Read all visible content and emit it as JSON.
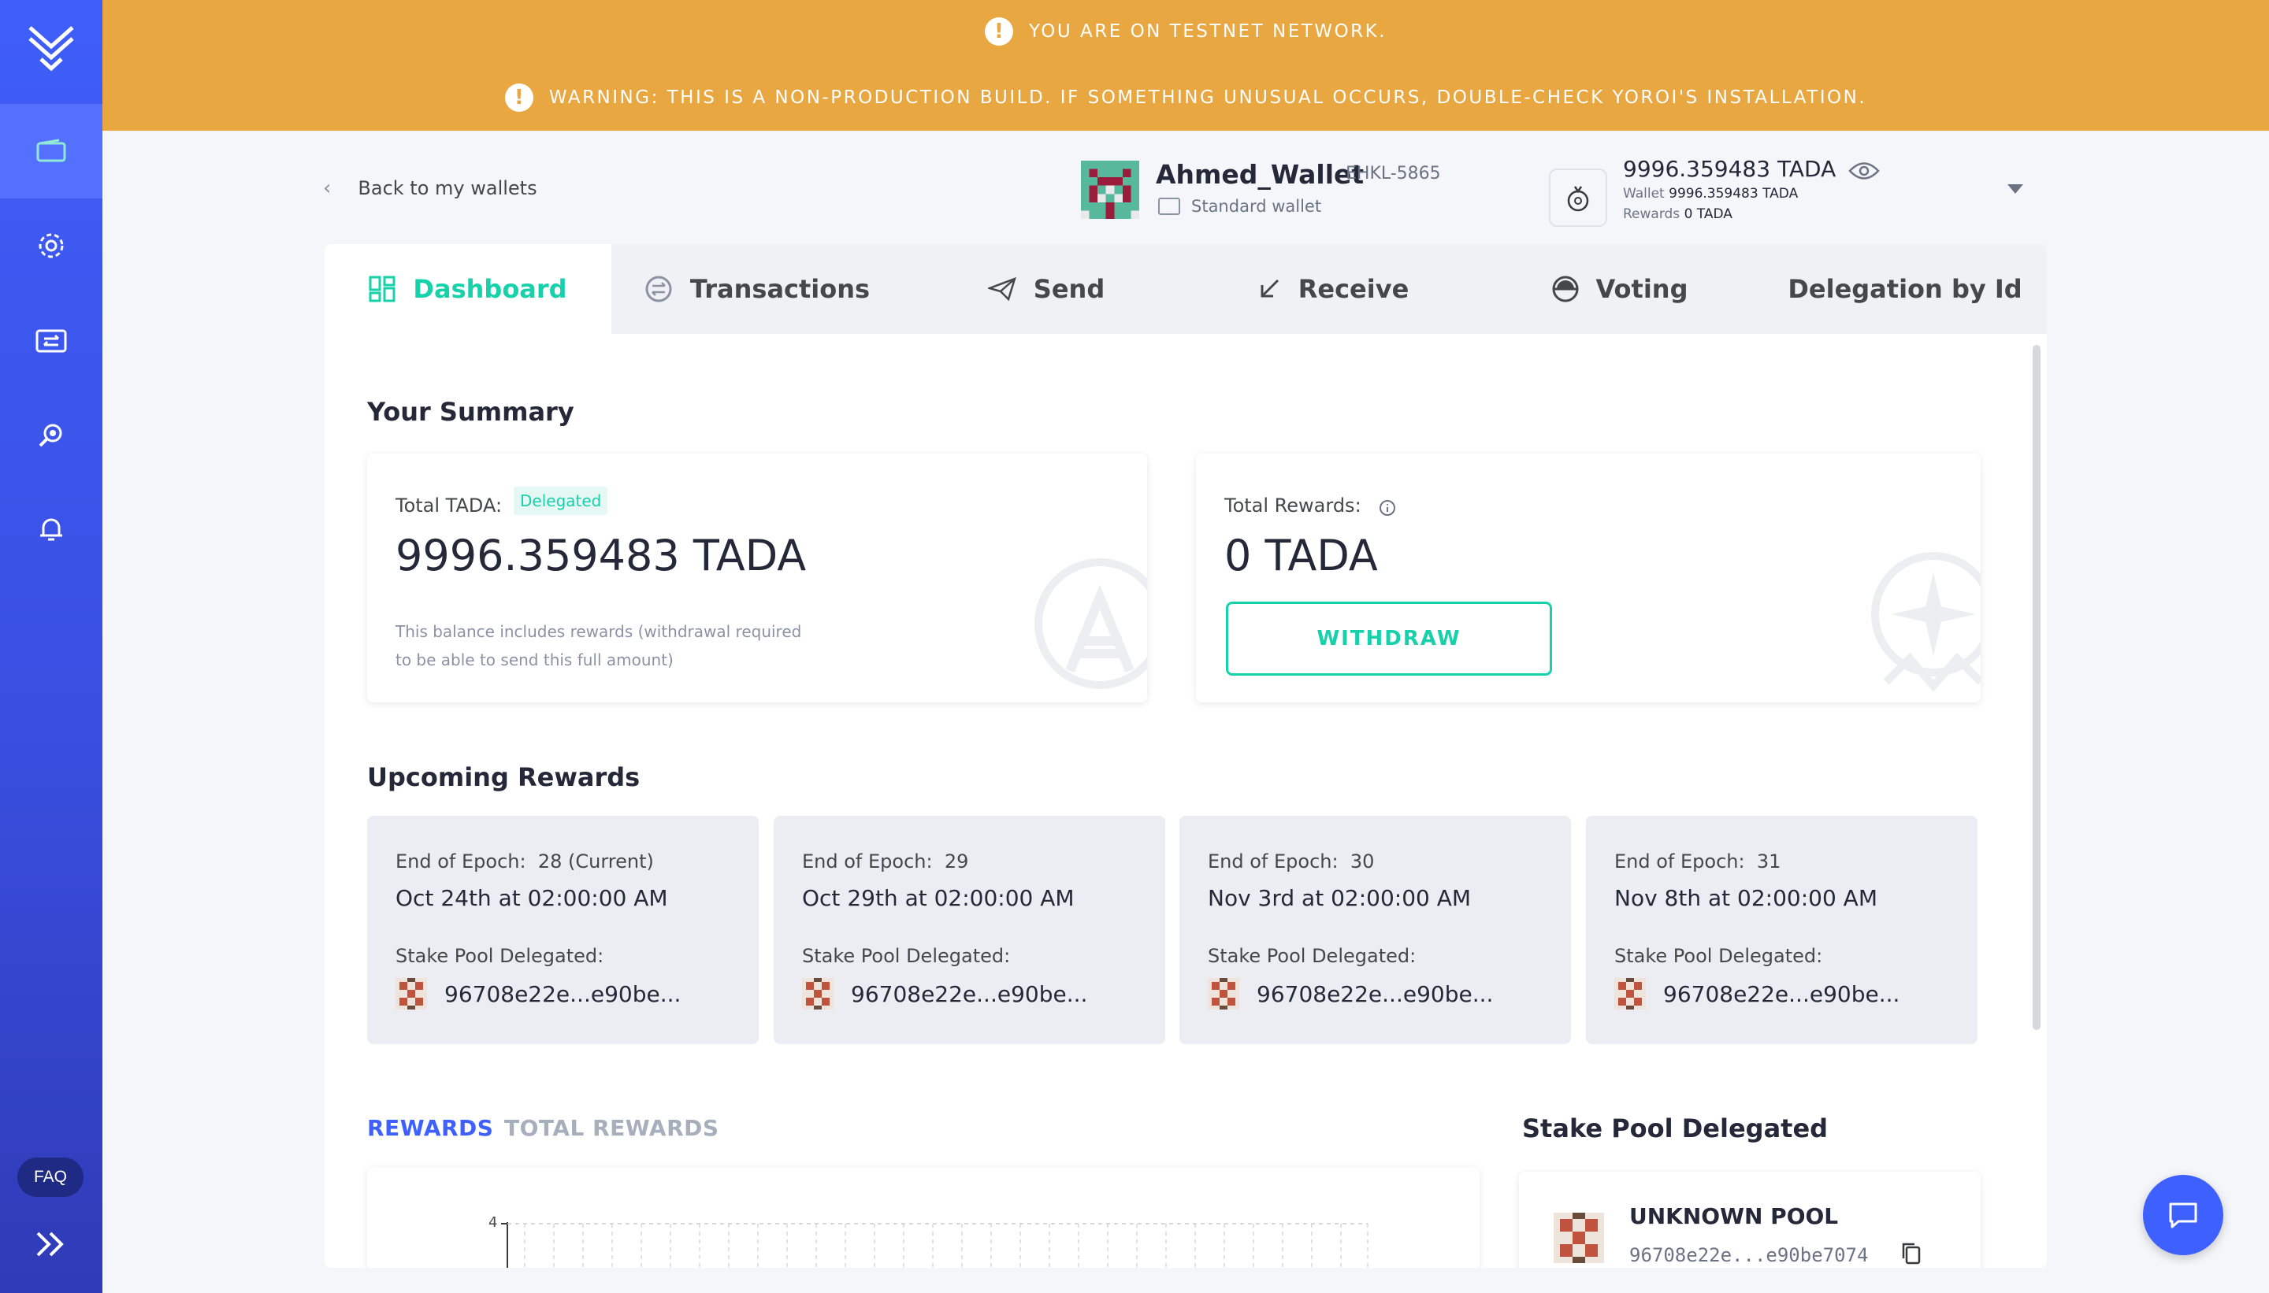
{
  "banners": {
    "testnet": "YOU ARE ON TESTNET NETWORK.",
    "warning": "WARNING: THIS IS A NON-PRODUCTION BUILD. IF SOMETHING UNUSUAL OCCURS, DOUBLE-CHECK YOROI'S INSTALLATION."
  },
  "sidebar": {
    "items": [
      {
        "name": "wallets",
        "icon": "wallet-icon",
        "active": true
      },
      {
        "name": "settings",
        "icon": "gear-icon",
        "active": false
      },
      {
        "name": "transfer",
        "icon": "transfer-icon",
        "active": false
      },
      {
        "name": "staking",
        "icon": "staking-icon",
        "active": false
      },
      {
        "name": "notifications",
        "icon": "bell-icon",
        "active": false
      }
    ],
    "faq": "FAQ"
  },
  "topbar": {
    "back": "Back to my wallets",
    "wallet_name": "Ahmed_Wallet",
    "wallet_plate": "EHKL-5865",
    "wallet_type": "Standard wallet",
    "balance": "9996.359483 TADA",
    "wallet_label": "Wallet",
    "wallet_value": "9996.359483 TADA",
    "rewards_label": "Rewards",
    "rewards_value": "0 TADA"
  },
  "tabs": [
    {
      "label": "Dashboard",
      "icon": "dashboard-icon",
      "active": true
    },
    {
      "label": "Transactions",
      "icon": "transactions-icon",
      "active": false
    },
    {
      "label": "Send",
      "icon": "send-icon",
      "active": false
    },
    {
      "label": "Receive",
      "icon": "receive-icon",
      "active": false
    },
    {
      "label": "Voting",
      "icon": "voting-icon",
      "active": false
    },
    {
      "label": "Delegation by Id",
      "icon": "",
      "active": false
    }
  ],
  "summary": {
    "title": "Your Summary",
    "total_label": "Total TADA:",
    "delegated_badge": "Delegated",
    "total_value": "9996.359483 TADA",
    "note": "This balance includes rewards (withdrawal required to be able to send this full amount)",
    "rewards_label": "Total Rewards:",
    "rewards_value": "0 TADA",
    "withdraw": "WITHDRAW"
  },
  "upcoming": {
    "title": "Upcoming Rewards",
    "epoch_label": "End of Epoch:",
    "pool_label": "Stake Pool Delegated:",
    "epochs": [
      {
        "epoch": "28 (Current)",
        "date": "Oct 24th at 02:00:00 AM",
        "pool": "96708e22e...e90be..."
      },
      {
        "epoch": "29",
        "date": "Oct 29th at 02:00:00 AM",
        "pool": "96708e22e...e90be..."
      },
      {
        "epoch": "30",
        "date": "Nov 3rd at 02:00:00 AM",
        "pool": "96708e22e...e90be..."
      },
      {
        "epoch": "31",
        "date": "Nov 8th at 02:00:00 AM",
        "pool": "96708e22e...e90be..."
      }
    ]
  },
  "rewards_tabs": {
    "rewards": "REWARDS",
    "total_rewards": "TOTAL REWARDS",
    "active_color": "#3e60ff",
    "inactive_color": "#a7aebc"
  },
  "chart": {
    "y_tick": "4"
  },
  "stake_pool": {
    "title": "Stake Pool Delegated",
    "name": "UNKNOWN POOL",
    "id": "96708e22e...e90be7074"
  },
  "colors": {
    "accent": "#17d1aa",
    "banner": "#e9a741",
    "sidebar": "#3f5ef8"
  }
}
